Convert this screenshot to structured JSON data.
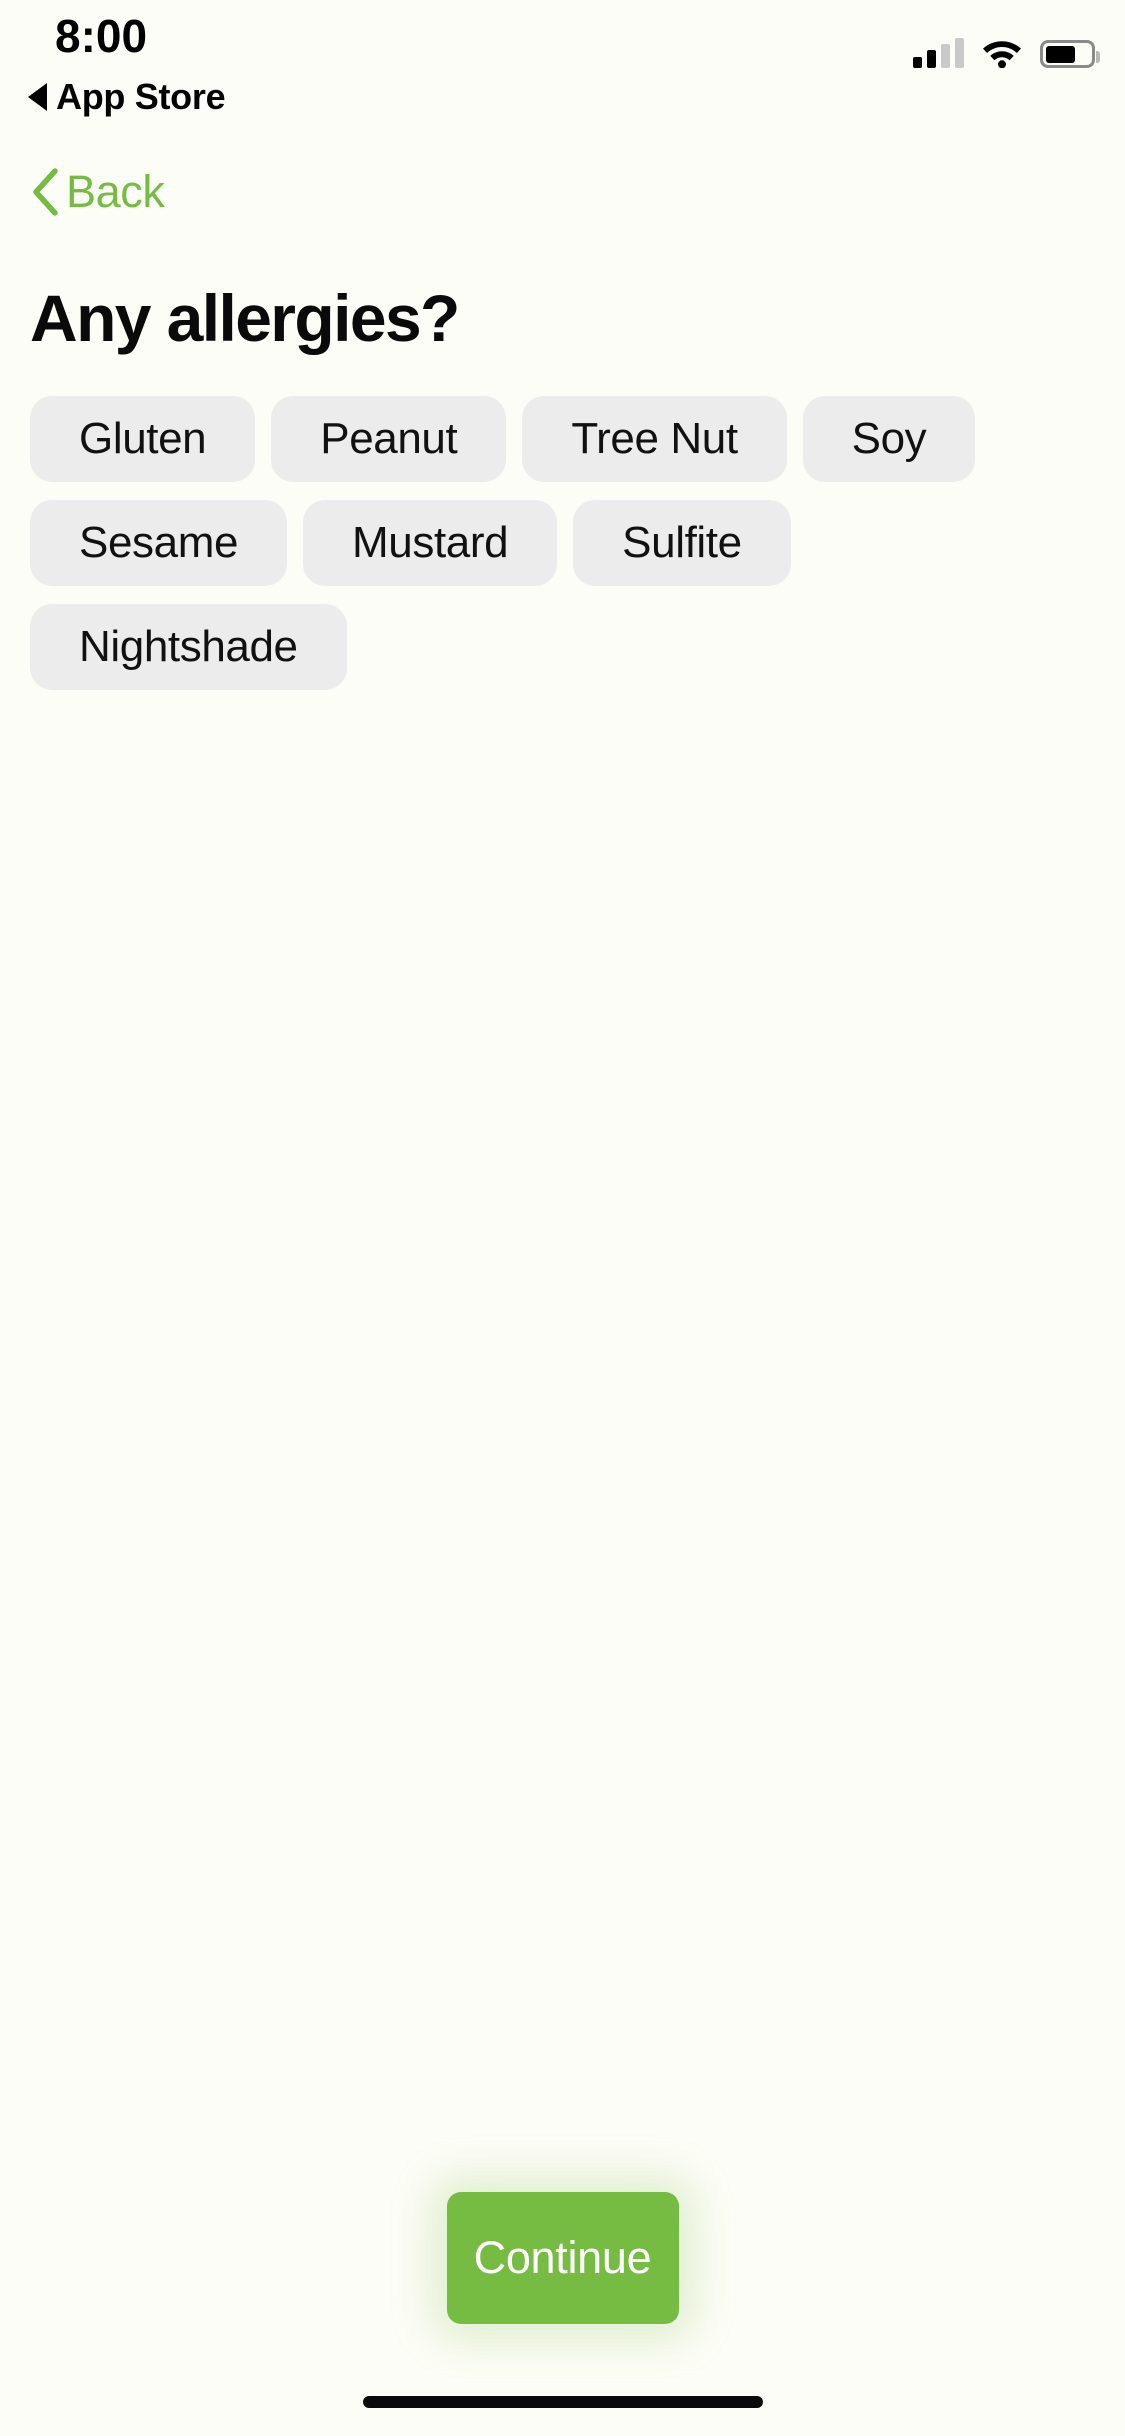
{
  "theme": {
    "background": "#FDFDF7",
    "accent_green": "#76BC43",
    "chip_bg": "#ECECEC",
    "text": "#0A0A0A"
  },
  "status_bar": {
    "time": "8:00",
    "return_to_app": "App Store",
    "return_icon": "back-triangle-icon",
    "cellular_icon": "cellular-signal-icon",
    "cellular_bars_filled": 2,
    "cellular_bars_total": 4,
    "wifi_icon": "wifi-icon",
    "battery_icon": "battery-icon",
    "battery_level_percent": 60
  },
  "navigation": {
    "back_icon": "chevron-left-icon",
    "back_label": "Back"
  },
  "main": {
    "title": "Any allergies?",
    "chips": [
      {
        "label": "Gluten",
        "selected": false
      },
      {
        "label": "Peanut",
        "selected": false
      },
      {
        "label": "Tree Nut",
        "selected": false
      },
      {
        "label": "Soy",
        "selected": false
      },
      {
        "label": "Sesame",
        "selected": false
      },
      {
        "label": "Mustard",
        "selected": false
      },
      {
        "label": "Sulfite",
        "selected": false
      },
      {
        "label": "Nightshade",
        "selected": false
      }
    ]
  },
  "footer": {
    "continue_label": "Continue"
  }
}
